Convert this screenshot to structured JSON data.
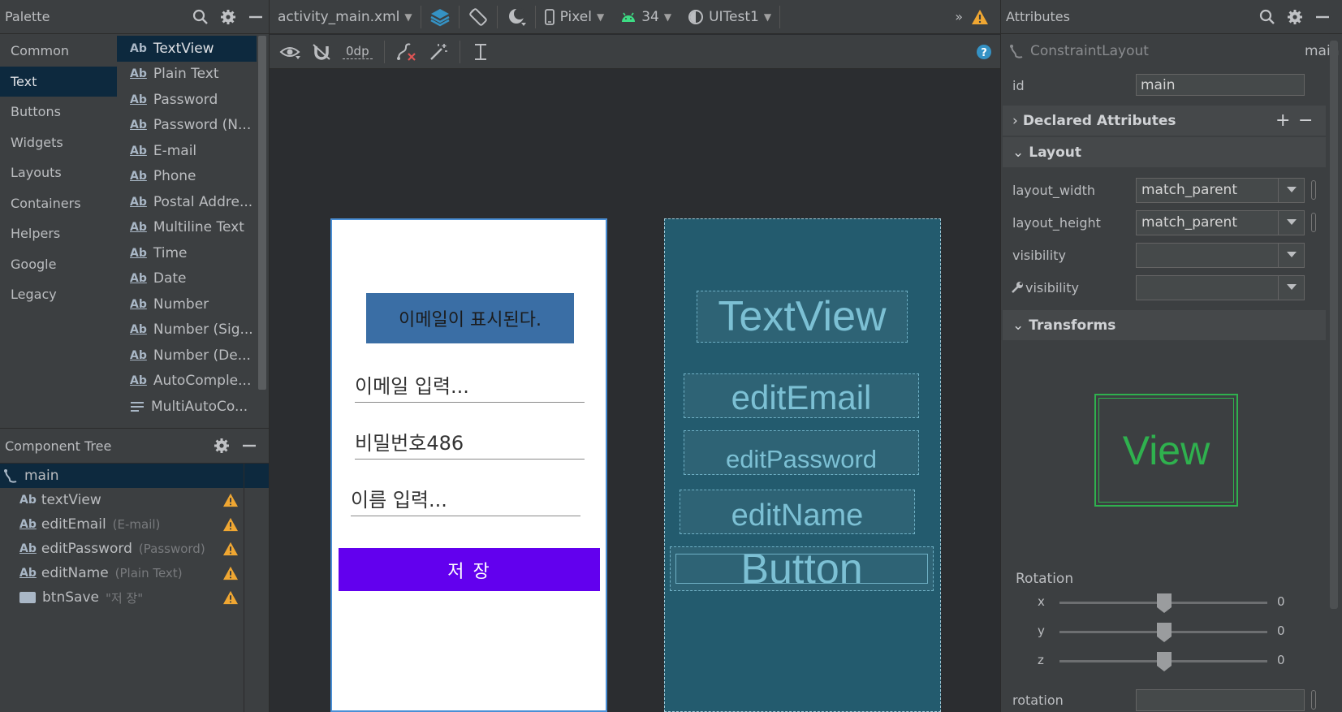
{
  "palette": {
    "title": "Palette",
    "categories": [
      "Common",
      "Text",
      "Buttons",
      "Widgets",
      "Layouts",
      "Containers",
      "Helpers",
      "Google",
      "Legacy"
    ],
    "selected_category": "Text",
    "widgets": [
      {
        "label": "TextView",
        "icon": "Ab"
      },
      {
        "label": "Plain Text",
        "icon": "Ab"
      },
      {
        "label": "Password",
        "icon": "Ab"
      },
      {
        "label": "Password (N...",
        "icon": "Ab"
      },
      {
        "label": "E-mail",
        "icon": "Ab"
      },
      {
        "label": "Phone",
        "icon": "Ab"
      },
      {
        "label": "Postal Addre...",
        "icon": "Ab"
      },
      {
        "label": "Multiline Text",
        "icon": "Ab"
      },
      {
        "label": "Time",
        "icon": "Ab"
      },
      {
        "label": "Date",
        "icon": "Ab"
      },
      {
        "label": "Number",
        "icon": "Ab"
      },
      {
        "label": "Number (Sig...",
        "icon": "Ab"
      },
      {
        "label": "Number (De...",
        "icon": "Ab"
      },
      {
        "label": "AutoComple...",
        "icon": "Ab"
      },
      {
        "label": "MultiAutoCo...",
        "icon": "list"
      }
    ]
  },
  "component_tree": {
    "title": "Component Tree",
    "root": "main",
    "items": [
      {
        "name": "textView",
        "sub": "",
        "icon": "Ab"
      },
      {
        "name": "editEmail",
        "sub": "(E-mail)",
        "icon": "Ab"
      },
      {
        "name": "editPassword",
        "sub": "(Password)",
        "icon": "Ab"
      },
      {
        "name": "editName",
        "sub": "(Plain Text)",
        "icon": "Ab"
      },
      {
        "name": "btnSave",
        "sub": "\"저 장\"",
        "icon": "button"
      }
    ]
  },
  "toolbar": {
    "file": "activity_main.xml",
    "device": "Pixel",
    "api": "34",
    "theme": "UITest1",
    "margin": "0dp",
    "more": "»"
  },
  "preview": {
    "textview": "이메일이 표시된다.",
    "email_hint": "이메일 입력...",
    "password_value": "비밀번호486",
    "name_hint": "이름 입력...",
    "button": "저 장"
  },
  "blueprint": {
    "textview": "TextView",
    "email": "editEmail",
    "password": "editPassword",
    "name": "editName",
    "button": "Button"
  },
  "attributes": {
    "title": "Attributes",
    "component": "ConstraintLayout",
    "component_id_right": "main",
    "id_label": "id",
    "id_value": "main",
    "declared": "Declared Attributes",
    "layout_section": "Layout",
    "layout_width_label": "layout_width",
    "layout_width_value": "match_parent",
    "layout_height_label": "layout_height",
    "layout_height_value": "match_parent",
    "visibility_label": "visibility",
    "tools_visibility_label": "visibility",
    "transforms_section": "Transforms",
    "view_preview": "View",
    "rotation_heading": "Rotation",
    "rot_x_label": "x",
    "rot_x": "0",
    "rot_y_label": "y",
    "rot_y": "0",
    "rot_z_label": "z",
    "rot_z": "0",
    "rotation_label": "rotation"
  },
  "colors": {
    "accent_selected": "#0d293e",
    "warning": "#f0a732",
    "button_purple": "#6200ee",
    "textview_blue": "#3a6ea5",
    "blueprint_bg": "#235b6e",
    "view_green": "#2fb14e"
  }
}
